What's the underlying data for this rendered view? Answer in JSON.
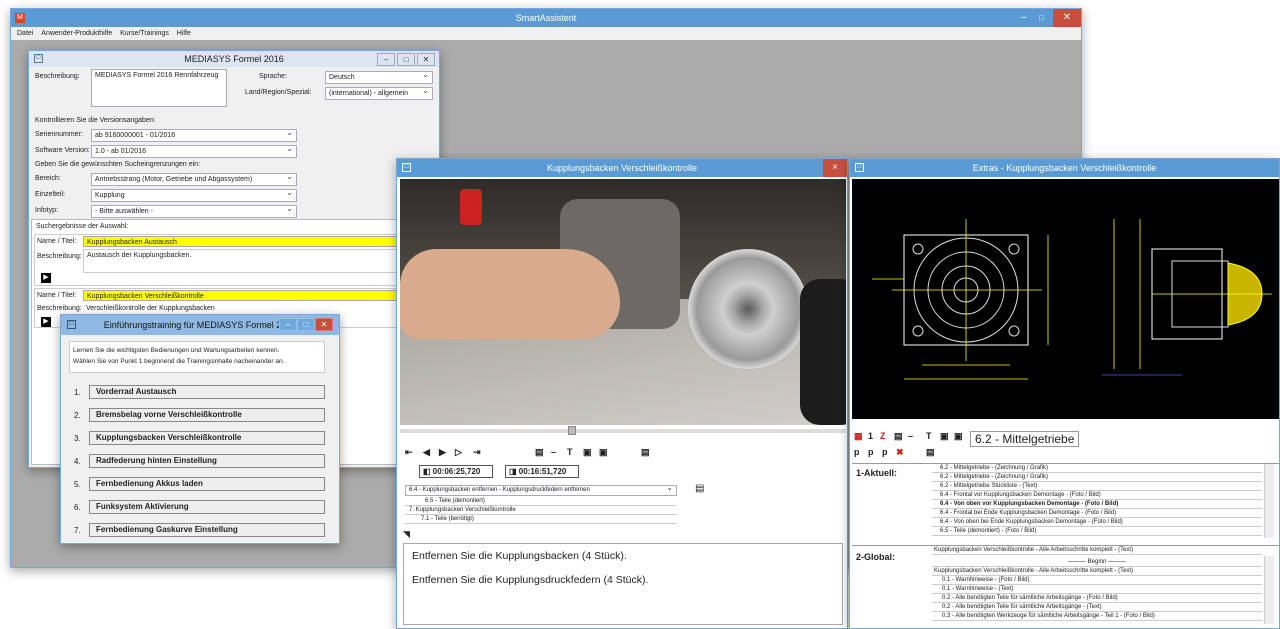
{
  "app": {
    "title": "SmartAssistent",
    "menu": [
      "Datei",
      "Anwender-Produkthilfe",
      "Kurse/Trainings",
      "Hilfe"
    ]
  },
  "product_window": {
    "title": "MEDIASYS Formel 2016",
    "beschreibung_label": "Beschreibung:",
    "beschreibung_value": "MEDIASYS Formel 2016 Rennfahrzeug",
    "sprache_label": "Sprache:",
    "sprache_value": "Deutsch",
    "land_label": "Land/Region/Spezial:",
    "land_value": "(international) - allgemein",
    "kontrolle_text": "Kontrollieren Sie die Versionsangaben:",
    "serien_label": "Seriennummer:",
    "serien_value": "ab 9160000001 - 01/2016",
    "software_label": "Software Version:",
    "software_value": "1.0 - ab 01/2016",
    "such_text": "Geben Sie die gewünschten Sucheingrenzungen ein:",
    "bereich_label": "Bereich:",
    "bereich_value": "Antriebsstrang (Motor, Getriebe und Abgassystem)",
    "einzelteil_label": "Einzelteil:",
    "einzelteil_value": "Kupplung",
    "infotyp_label": "Infotyp:",
    "infotyp_value": "- Bitte auswählen -",
    "results_label": "Suchergebnisse der Auswahl:",
    "results": [
      {
        "name_label": "Name / Titel:",
        "name_value": "Kupplungsbacken Austausch",
        "desc_label": "Beschreibung:",
        "desc_value": "Austausch der Kupplungsbacken."
      },
      {
        "name_label": "Name / Titel:",
        "name_value": "Kupplungsbacken Verschleißkontrolle",
        "desc_label": "Beschreibung:",
        "desc_value": "Verschleißkontrolle der Kupplungsbacken"
      }
    ]
  },
  "training_window": {
    "title": "Einführungstraining für MEDIASYS Formel 2016",
    "intro1": "Lernen Sie die wichtigsten Bedienungen und Wartungsarbeiten kennen.",
    "intro2": "Wählen Sie von Punkt 1 beginnend die Trainingsinhalte nacheinander an.",
    "items": [
      {
        "num": "1.",
        "label": "Vorderrad Austausch"
      },
      {
        "num": "2.",
        "label": "Bremsbelag vorne Verschleißkontrolle"
      },
      {
        "num": "3.",
        "label": "Kupplungsbacken Verschleißkontrolle"
      },
      {
        "num": "4.",
        "label": "Radfederung hinten Einstellung"
      },
      {
        "num": "5.",
        "label": "Fernbedienung Akkus laden"
      },
      {
        "num": "6.",
        "label": "Funksystem Aktivierung"
      },
      {
        "num": "7.",
        "label": "Fernbedienung Gaskurve Einstellung"
      }
    ]
  },
  "video_window": {
    "title": "Kupplungsbacken Verschleißkontrolle",
    "close": "×",
    "time_current": "00:06:25,720",
    "time_total": "00:16:51,720",
    "chapter_selected": "6.4 - Kupplungsbacken entfernen - Kupplungsdruckfedern entfernen",
    "chapters": [
      "6.5 - Teile (demontiert)",
      "7. Kupplungsbacken Verschleißkontrolle",
      "7.1 - Teile (benötigt)"
    ],
    "text_lines": [
      "Entfernen Sie die Kupplungsbacken (4 Stück).",
      "Entfernen Sie die Kupplungsdruckfedern (4 Stück)."
    ]
  },
  "extras_window": {
    "title": "Extras - Kupplungsbacken Verschleißkontrolle",
    "heading": "6.2 - Mittelgetriebe",
    "aktuell_label": "1-Aktuell:",
    "aktuell_items": [
      "6.2 - Mittelgetriebe - (Zeichnung / Grafik)",
      "6.2 - Mittelgetriebe - (Zeichnung / Grafik)",
      "6.2 - Mittelgetriebe Stückliste - (Text)",
      "6.4 - Frontal vor Kupplungsbacken Demontage - (Foto / Bild)",
      "6.4 - Von oben vor Kupplungsbacken Demontage - (Foto / Bild)",
      "6.4 - Frontal bei Ende Kupplungsbacken Demontage - (Foto / Bild)",
      "6.4 - Von oben bei Ende Kupplungsbacken Demontage - (Foto / Bild)",
      "6.5 - Teile (demontiert) - (Foto / Bild)"
    ],
    "global_label": "2-Global:",
    "global_items": [
      "Kupplungsbacken Verschleißkontrolle - Alle Arbeitsschritte komplett - (Text)",
      "——— Beginn ———",
      "Kupplungsbacken Verschleißkontrolle - Alle Arbeitsschritte komplett - (Text)",
      "0.1 - Warnhinweise - (Foto / Bild)",
      "0.1 - Warnhinweise - (Text)",
      "0.2 - Alle benötigten Teile für sämtliche Arbeitsgänge - (Foto / Bild)",
      "0.2 - Alle benötigten Teile für sämtliche Arbeitsgänge - (Text)",
      "0.3 - Alle benötigten Werkzeuge für sämtliche Arbeitsgänge - Teil 1 - (Foto / Bild)"
    ]
  },
  "colors": {
    "titlebar": "#5b9bd5",
    "highlight": "#ffff00",
    "close": "#c7503d"
  }
}
